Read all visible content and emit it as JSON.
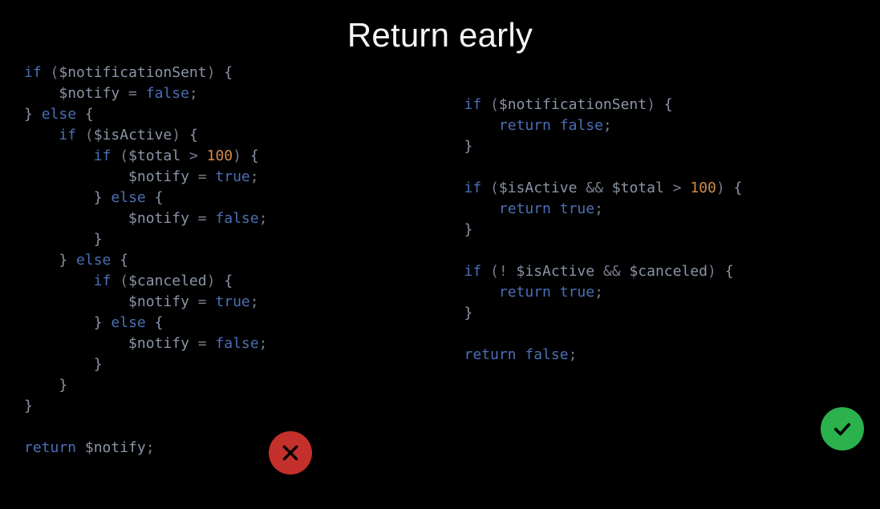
{
  "title": "Return early",
  "bad_code": {
    "tokens": [
      [
        [
          "kw",
          "if"
        ],
        [
          "op",
          " ("
        ],
        [
          "var",
          "$notificationSent"
        ],
        [
          "op",
          ") "
        ],
        [
          "punc",
          "{"
        ]
      ],
      [
        [
          "op",
          "    "
        ],
        [
          "var",
          "$notify"
        ],
        [
          "op",
          " = "
        ],
        [
          "bool",
          "false"
        ],
        [
          "op",
          ";"
        ]
      ],
      [
        [
          "punc",
          "} "
        ],
        [
          "kw",
          "else"
        ],
        [
          "punc",
          " {"
        ]
      ],
      [
        [
          "op",
          "    "
        ],
        [
          "kw",
          "if"
        ],
        [
          "op",
          " ("
        ],
        [
          "var",
          "$isActive"
        ],
        [
          "op",
          ") "
        ],
        [
          "punc",
          "{"
        ]
      ],
      [
        [
          "op",
          "        "
        ],
        [
          "kw",
          "if"
        ],
        [
          "op",
          " ("
        ],
        [
          "var",
          "$total"
        ],
        [
          "op",
          " > "
        ],
        [
          "num",
          "100"
        ],
        [
          "op",
          ") "
        ],
        [
          "punc",
          "{"
        ]
      ],
      [
        [
          "op",
          "            "
        ],
        [
          "var",
          "$notify"
        ],
        [
          "op",
          " = "
        ],
        [
          "bool",
          "true"
        ],
        [
          "op",
          ";"
        ]
      ],
      [
        [
          "op",
          "        "
        ],
        [
          "punc",
          "} "
        ],
        [
          "kw",
          "else"
        ],
        [
          "punc",
          " {"
        ]
      ],
      [
        [
          "op",
          "            "
        ],
        [
          "var",
          "$notify"
        ],
        [
          "op",
          " = "
        ],
        [
          "bool",
          "false"
        ],
        [
          "op",
          ";"
        ]
      ],
      [
        [
          "op",
          "        "
        ],
        [
          "punc",
          "}"
        ]
      ],
      [
        [
          "op",
          "    "
        ],
        [
          "punc",
          "} "
        ],
        [
          "kw",
          "else"
        ],
        [
          "punc",
          " {"
        ]
      ],
      [
        [
          "op",
          "        "
        ],
        [
          "kw",
          "if"
        ],
        [
          "op",
          " ("
        ],
        [
          "var",
          "$canceled"
        ],
        [
          "op",
          ") "
        ],
        [
          "punc",
          "{"
        ]
      ],
      [
        [
          "op",
          "            "
        ],
        [
          "var",
          "$notify"
        ],
        [
          "op",
          " = "
        ],
        [
          "bool",
          "true"
        ],
        [
          "op",
          ";"
        ]
      ],
      [
        [
          "op",
          "        "
        ],
        [
          "punc",
          "} "
        ],
        [
          "kw",
          "else"
        ],
        [
          "punc",
          " {"
        ]
      ],
      [
        [
          "op",
          "            "
        ],
        [
          "var",
          "$notify"
        ],
        [
          "op",
          " = "
        ],
        [
          "bool",
          "false"
        ],
        [
          "op",
          ";"
        ]
      ],
      [
        [
          "op",
          "        "
        ],
        [
          "punc",
          "}"
        ]
      ],
      [
        [
          "op",
          "    "
        ],
        [
          "punc",
          "}"
        ]
      ],
      [
        [
          "punc",
          "}"
        ]
      ],
      [
        [
          "op",
          " "
        ]
      ],
      [
        [
          "kw",
          "return"
        ],
        [
          "op",
          " "
        ],
        [
          "var",
          "$notify"
        ],
        [
          "op",
          ";"
        ]
      ]
    ]
  },
  "good_code": {
    "tokens": [
      [
        [
          "kw",
          "if"
        ],
        [
          "op",
          " ("
        ],
        [
          "var",
          "$notificationSent"
        ],
        [
          "op",
          ") "
        ],
        [
          "punc",
          "{"
        ]
      ],
      [
        [
          "op",
          "    "
        ],
        [
          "kw",
          "return"
        ],
        [
          "op",
          " "
        ],
        [
          "bool",
          "false"
        ],
        [
          "op",
          ";"
        ]
      ],
      [
        [
          "punc",
          "}"
        ]
      ],
      [
        [
          "op",
          " "
        ]
      ],
      [
        [
          "kw",
          "if"
        ],
        [
          "op",
          " ("
        ],
        [
          "var",
          "$isActive"
        ],
        [
          "op",
          " && "
        ],
        [
          "var",
          "$total"
        ],
        [
          "op",
          " > "
        ],
        [
          "num",
          "100"
        ],
        [
          "op",
          ") "
        ],
        [
          "punc",
          "{"
        ]
      ],
      [
        [
          "op",
          "    "
        ],
        [
          "kw",
          "return"
        ],
        [
          "op",
          " "
        ],
        [
          "bool",
          "true"
        ],
        [
          "op",
          ";"
        ]
      ],
      [
        [
          "punc",
          "}"
        ]
      ],
      [
        [
          "op",
          " "
        ]
      ],
      [
        [
          "kw",
          "if"
        ],
        [
          "op",
          " (! "
        ],
        [
          "var",
          "$isActive"
        ],
        [
          "op",
          " && "
        ],
        [
          "var",
          "$canceled"
        ],
        [
          "op",
          ") "
        ],
        [
          "punc",
          "{"
        ]
      ],
      [
        [
          "op",
          "    "
        ],
        [
          "kw",
          "return"
        ],
        [
          "op",
          " "
        ],
        [
          "bool",
          "true"
        ],
        [
          "op",
          ";"
        ]
      ],
      [
        [
          "punc",
          "}"
        ]
      ],
      [
        [
          "op",
          " "
        ]
      ],
      [
        [
          "kw",
          "return"
        ],
        [
          "op",
          " "
        ],
        [
          "bool",
          "false"
        ],
        [
          "op",
          ";"
        ]
      ]
    ]
  },
  "badges": {
    "bad": "cross-icon",
    "good": "check-icon"
  }
}
